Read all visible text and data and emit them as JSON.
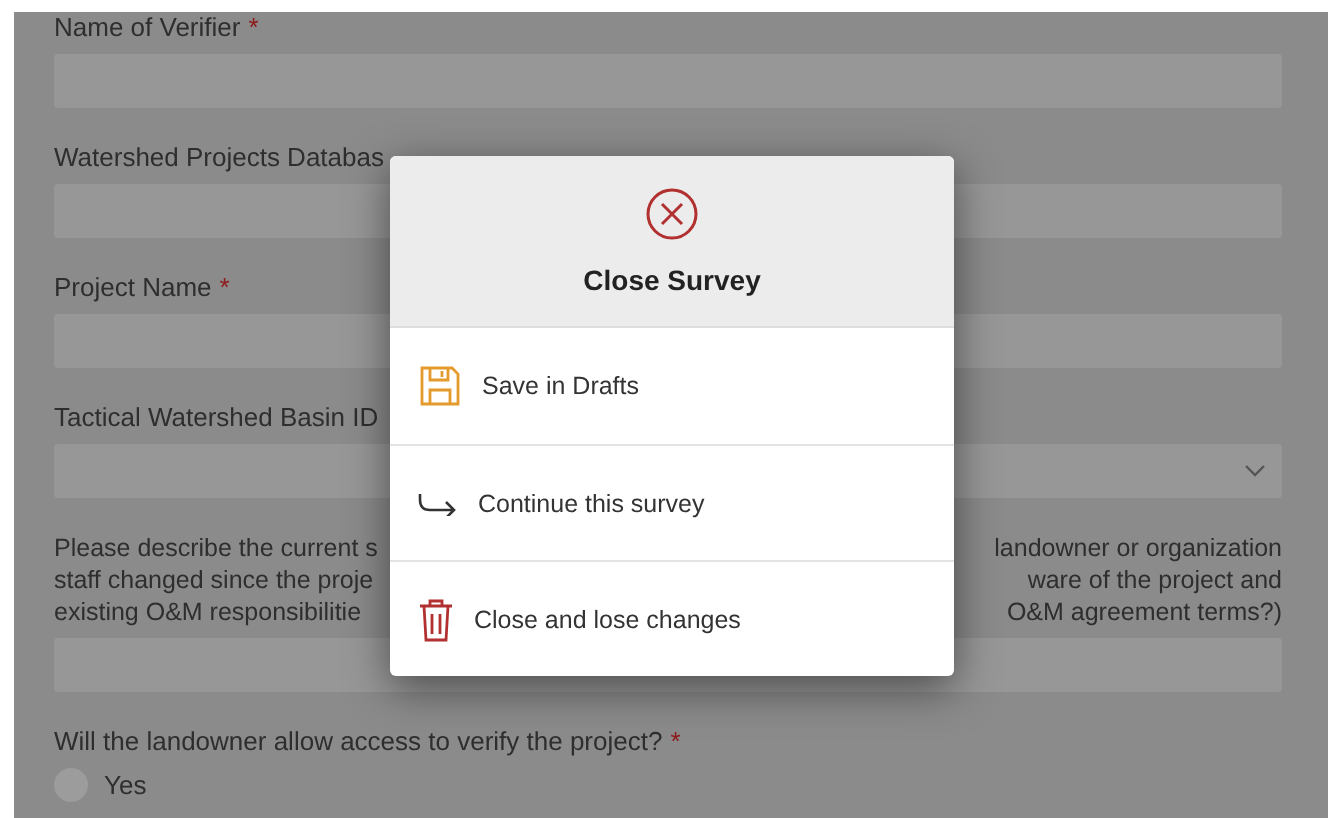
{
  "form": {
    "items": [
      {
        "kind": "text",
        "label": "Name of Verifier",
        "required_mark": "*"
      },
      {
        "kind": "text",
        "label": "Watershed Projects Databas"
      },
      {
        "kind": "text",
        "label": "Project Name",
        "required_mark": "*"
      },
      {
        "kind": "select",
        "label": "Tactical Watershed Basin ID"
      },
      {
        "kind": "paragraph",
        "lines": [
          {
            "left": "Please describe the current s",
            "right": "landowner or organization"
          },
          {
            "left": "staff changed since the proje",
            "right": "ware of the project and"
          },
          {
            "left": "existing O&M responsibilitie",
            "right": "O&M agreement terms?)"
          }
        ]
      },
      {
        "kind": "radio",
        "label": "Will the landowner allow access to verify the project?",
        "required_mark": "*",
        "options": [
          {
            "label": "Yes",
            "selected": false
          }
        ]
      }
    ]
  },
  "dialog": {
    "title": "Close Survey",
    "actions": [
      {
        "kind": "save",
        "label": "Save in Drafts"
      },
      {
        "kind": "continue",
        "label": "Continue this survey"
      },
      {
        "kind": "discard",
        "label": "Close and lose changes"
      }
    ]
  }
}
